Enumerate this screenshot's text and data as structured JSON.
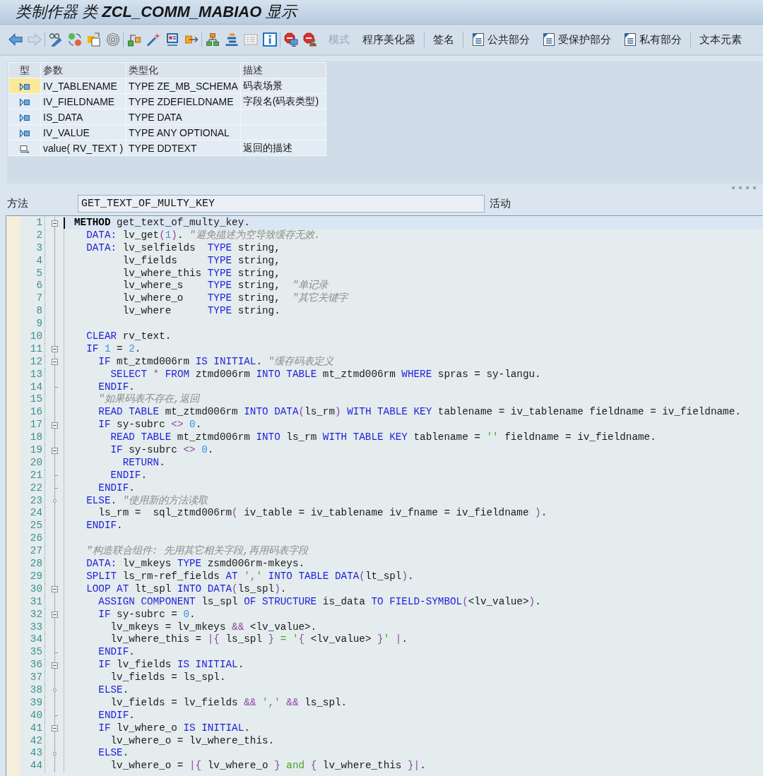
{
  "title": "类制作器 类 **ZCL_COMM_MABIAO** 显示",
  "toolbar": {
    "nav": [
      {
        "disabled": false
      },
      {
        "disabled": true
      }
    ],
    "buttons": [
      {
        "label": "模式",
        "kind": "plain",
        "disabled": true,
        "separator_before": false
      },
      {
        "label": "程序美化器",
        "kind": "plain",
        "disabled": false,
        "separator_before": false
      },
      {
        "label": "签名",
        "kind": "plain",
        "disabled": false,
        "separator_before": true
      },
      {
        "label": "公共部分",
        "kind": "section",
        "disabled": false,
        "separator_before": true
      },
      {
        "label": "受保护部分",
        "kind": "section",
        "disabled": false,
        "separator_before": false
      },
      {
        "label": "私有部分",
        "kind": "section",
        "disabled": false,
        "separator_before": false
      },
      {
        "label": "文本元素",
        "kind": "plain",
        "disabled": false,
        "separator_before": true
      }
    ]
  },
  "parameters": {
    "columns": [
      "型",
      "参数",
      "类型化",
      "描述"
    ],
    "rows": [
      {
        "kind": "importing",
        "selected": true,
        "parameter": "IV_TABLENAME",
        "typing": "TYPE ZE_MB_SCHEMA",
        "description": "码表场景"
      },
      {
        "kind": "importing",
        "selected": false,
        "parameter": "IV_FIELDNAME",
        "typing": "TYPE ZDEFIELDNAME",
        "description": "字段名(码表类型)"
      },
      {
        "kind": "importing",
        "selected": false,
        "parameter": "IS_DATA",
        "typing": "TYPE DATA"
      },
      {
        "kind": "importing",
        "selected": false,
        "parameter": "IV_VALUE",
        "typing": "TYPE ANY OPTIONAL"
      },
      {
        "kind": "returning",
        "selected": false,
        "parameter": "value( RV_TEXT )",
        "typing": "TYPE DDTEXT",
        "description": "返回的描述"
      }
    ]
  },
  "method": {
    "label": "方法",
    "name": "GET_TEXT_OF_MULTY_KEY",
    "status": "活动"
  },
  "code": {
    "lines": [
      {
        "number": "1",
        "current": true,
        "kind": "block_start",
        "tokens": [
          {
            "kind": "bold",
            "text": "METHOD"
          },
          {
            "kind": "plain",
            "text": " get_text_of_multy_key."
          }
        ]
      },
      {
        "number": "2",
        "current": false,
        "kind": "line",
        "tokens": [
          {
            "kind": "keyword",
            "text": "  DATA:"
          },
          {
            "kind": "plain",
            "text": " lv_get"
          },
          {
            "kind": "operator",
            "text": "("
          },
          {
            "kind": "number",
            "text": "1"
          },
          {
            "kind": "operator",
            "text": ")"
          },
          {
            "kind": "plain",
            "text": ". "
          },
          {
            "kind": "comment",
            "text": "\"避免描述为空导致缓存无效."
          }
        ]
      },
      {
        "number": "3",
        "current": false,
        "kind": "line",
        "tokens": [
          {
            "kind": "keyword",
            "text": "  DATA:"
          },
          {
            "kind": "plain",
            "text": " lv_selfields  "
          },
          {
            "kind": "keyword",
            "text": "TYPE"
          },
          {
            "kind": "plain",
            "text": " string,"
          }
        ]
      },
      {
        "number": "4",
        "current": false,
        "kind": "line",
        "tokens": [
          {
            "kind": "plain",
            "text": "        lv_fields     "
          },
          {
            "kind": "keyword",
            "text": "TYPE"
          },
          {
            "kind": "plain",
            "text": " string,"
          }
        ]
      },
      {
        "number": "5",
        "current": false,
        "kind": "line",
        "tokens": [
          {
            "kind": "plain",
            "text": "        lv_where_this "
          },
          {
            "kind": "keyword",
            "text": "TYPE"
          },
          {
            "kind": "plain",
            "text": " string,"
          }
        ]
      },
      {
        "number": "6",
        "current": false,
        "kind": "line",
        "tokens": [
          {
            "kind": "plain",
            "text": "        lv_where_s    "
          },
          {
            "kind": "keyword",
            "text": "TYPE"
          },
          {
            "kind": "plain",
            "text": " string,  "
          },
          {
            "kind": "comment",
            "text": "\"单记录"
          }
        ]
      },
      {
        "number": "7",
        "current": false,
        "kind": "line",
        "tokens": [
          {
            "kind": "plain",
            "text": "        lv_where_o    "
          },
          {
            "kind": "keyword",
            "text": "TYPE"
          },
          {
            "kind": "plain",
            "text": " string,  "
          },
          {
            "kind": "comment",
            "text": "\"其它关键字"
          }
        ]
      },
      {
        "number": "8",
        "current": false,
        "kind": "line",
        "tokens": [
          {
            "kind": "plain",
            "text": "        lv_where      "
          },
          {
            "kind": "keyword",
            "text": "TYPE"
          },
          {
            "kind": "plain",
            "text": " string."
          }
        ]
      },
      {
        "number": "9",
        "current": false,
        "kind": "line"
      },
      {
        "number": "10",
        "current": false,
        "kind": "line",
        "tokens": [
          {
            "kind": "keyword",
            "text": "  CLEAR"
          },
          {
            "kind": "plain",
            "text": " rv_text."
          }
        ]
      },
      {
        "number": "11",
        "current": false,
        "kind": "block_start",
        "tokens": [
          {
            "kind": "keyword",
            "text": "  IF "
          },
          {
            "kind": "number",
            "text": "1"
          },
          {
            "kind": "plain",
            "text": " = "
          },
          {
            "kind": "number",
            "text": "2"
          },
          {
            "kind": "plain",
            "text": "."
          }
        ]
      },
      {
        "number": "12",
        "current": false,
        "kind": "block_start",
        "tokens": [
          {
            "kind": "keyword",
            "text": "    IF"
          },
          {
            "kind": "plain",
            "text": " mt_ztmd006rm "
          },
          {
            "kind": "keyword",
            "text": "IS INITIAL"
          },
          {
            "kind": "plain",
            "text": ". "
          },
          {
            "kind": "comment",
            "text": "\"缓存码表定义"
          }
        ]
      },
      {
        "number": "13",
        "current": false,
        "kind": "line",
        "tokens": [
          {
            "kind": "keyword",
            "text": "      SELECT "
          },
          {
            "kind": "operator",
            "text": "*"
          },
          {
            "kind": "keyword",
            "text": " FROM"
          },
          {
            "kind": "plain",
            "text": " ztmd006rm "
          },
          {
            "kind": "keyword",
            "text": "INTO TABLE"
          },
          {
            "kind": "plain",
            "text": " mt_ztmd006rm "
          },
          {
            "kind": "keyword",
            "text": "WHERE"
          },
          {
            "kind": "plain",
            "text": " spras = sy-langu."
          }
        ]
      },
      {
        "number": "14",
        "current": false,
        "kind": "block_end",
        "tokens": [
          {
            "kind": "keyword",
            "text": "    ENDIF"
          },
          {
            "kind": "plain",
            "text": "."
          }
        ]
      },
      {
        "number": "15",
        "current": false,
        "kind": "line",
        "tokens": [
          {
            "kind": "comment",
            "text": "    \"如果码表不存在,返回"
          }
        ]
      },
      {
        "number": "16",
        "current": false,
        "kind": "line",
        "tokens": [
          {
            "kind": "keyword",
            "text": "    READ TABLE"
          },
          {
            "kind": "plain",
            "text": " mt_ztmd006rm "
          },
          {
            "kind": "keyword",
            "text": "INTO DATA"
          },
          {
            "kind": "operator",
            "text": "("
          },
          {
            "kind": "plain",
            "text": "ls_rm"
          },
          {
            "kind": "operator",
            "text": ")"
          },
          {
            "kind": "keyword",
            "text": " WITH TABLE KEY"
          },
          {
            "kind": "plain",
            "text": " tablename = iv_tablename fieldname = iv_fieldname."
          }
        ]
      },
      {
        "number": "17",
        "current": false,
        "kind": "block_start",
        "tokens": [
          {
            "kind": "keyword",
            "text": "    IF"
          },
          {
            "kind": "plain",
            "text": " sy-subrc "
          },
          {
            "kind": "operator",
            "text": "<>"
          },
          {
            "kind": "number",
            "text": " 0"
          },
          {
            "kind": "plain",
            "text": "."
          }
        ]
      },
      {
        "number": "18",
        "current": false,
        "kind": "line",
        "tokens": [
          {
            "kind": "keyword",
            "text": "      READ TABLE"
          },
          {
            "kind": "plain",
            "text": " mt_ztmd006rm "
          },
          {
            "kind": "keyword",
            "text": "INTO"
          },
          {
            "kind": "plain",
            "text": " ls_rm "
          },
          {
            "kind": "keyword",
            "text": "WITH TABLE KEY"
          },
          {
            "kind": "plain",
            "text": " tablename = "
          },
          {
            "kind": "string",
            "text": "''"
          },
          {
            "kind": "plain",
            "text": " fieldname = iv_fieldname."
          }
        ]
      },
      {
        "number": "19",
        "current": false,
        "kind": "block_start",
        "tokens": [
          {
            "kind": "keyword",
            "text": "      IF"
          },
          {
            "kind": "plain",
            "text": " sy-subrc "
          },
          {
            "kind": "operator",
            "text": "<>"
          },
          {
            "kind": "number",
            "text": " 0"
          },
          {
            "kind": "plain",
            "text": "."
          }
        ]
      },
      {
        "number": "20",
        "current": false,
        "kind": "line",
        "tokens": [
          {
            "kind": "keyword",
            "text": "        RETURN"
          },
          {
            "kind": "plain",
            "text": "."
          }
        ]
      },
      {
        "number": "21",
        "current": false,
        "kind": "block_end",
        "tokens": [
          {
            "kind": "keyword",
            "text": "      ENDIF"
          },
          {
            "kind": "plain",
            "text": "."
          }
        ]
      },
      {
        "number": "22",
        "current": false,
        "kind": "block_end",
        "tokens": [
          {
            "kind": "keyword",
            "text": "    ENDIF"
          },
          {
            "kind": "plain",
            "text": "."
          }
        ]
      },
      {
        "number": "23",
        "current": false,
        "kind": "block_branch",
        "tokens": [
          {
            "kind": "keyword",
            "text": "  ELSE"
          },
          {
            "kind": "plain",
            "text": ". "
          },
          {
            "kind": "comment",
            "text": "\"使用新的方法读取"
          }
        ]
      },
      {
        "number": "24",
        "current": false,
        "kind": "line",
        "tokens": [
          {
            "kind": "plain",
            "text": "    ls_rm =  sql_ztmd006rm"
          },
          {
            "kind": "operator",
            "text": "("
          },
          {
            "kind": "plain",
            "text": " iv_table = iv_tablename iv_fname = iv_fieldname "
          },
          {
            "kind": "operator",
            "text": ")"
          },
          {
            "kind": "plain",
            "text": "."
          }
        ]
      },
      {
        "number": "25",
        "current": false,
        "kind": "line",
        "tokens": [
          {
            "kind": "keyword",
            "text": "  ENDIF"
          },
          {
            "kind": "plain",
            "text": "."
          }
        ]
      },
      {
        "number": "26",
        "current": false,
        "kind": "line"
      },
      {
        "number": "27",
        "current": false,
        "kind": "line",
        "tokens": [
          {
            "kind": "comment",
            "text": "  \"构造联合组件: 先用其它相关字段,再用码表字段"
          }
        ]
      },
      {
        "number": "28",
        "current": false,
        "kind": "line",
        "tokens": [
          {
            "kind": "keyword",
            "text": "  DATA:"
          },
          {
            "kind": "plain",
            "text": " lv_mkeys "
          },
          {
            "kind": "keyword",
            "text": "TYPE"
          },
          {
            "kind": "plain",
            "text": " zsmd006rm-mkeys."
          }
        ]
      },
      {
        "number": "29",
        "current": false,
        "kind": "line",
        "tokens": [
          {
            "kind": "keyword",
            "text": "  SPLIT"
          },
          {
            "kind": "plain",
            "text": " ls_rm-ref_fields "
          },
          {
            "kind": "keyword",
            "text": "AT "
          },
          {
            "kind": "string",
            "text": "','"
          },
          {
            "kind": "keyword",
            "text": " INTO TABLE DATA"
          },
          {
            "kind": "operator",
            "text": "("
          },
          {
            "kind": "plain",
            "text": "lt_spl"
          },
          {
            "kind": "operator",
            "text": ")"
          },
          {
            "kind": "plain",
            "text": "."
          }
        ]
      },
      {
        "number": "30",
        "current": false,
        "kind": "block_start",
        "tokens": [
          {
            "kind": "keyword",
            "text": "  LOOP AT"
          },
          {
            "kind": "plain",
            "text": " lt_spl "
          },
          {
            "kind": "keyword",
            "text": "INTO DATA"
          },
          {
            "kind": "operator",
            "text": "("
          },
          {
            "kind": "plain",
            "text": "ls_spl"
          },
          {
            "kind": "operator",
            "text": ")"
          },
          {
            "kind": "plain",
            "text": "."
          }
        ]
      },
      {
        "number": "31",
        "current": false,
        "kind": "line",
        "tokens": [
          {
            "kind": "keyword",
            "text": "    ASSIGN COMPONENT"
          },
          {
            "kind": "plain",
            "text": " ls_spl "
          },
          {
            "kind": "keyword",
            "text": "OF STRUCTURE"
          },
          {
            "kind": "plain",
            "text": " is_data "
          },
          {
            "kind": "keyword",
            "text": "TO FIELD-SYMBOL"
          },
          {
            "kind": "operator",
            "text": "("
          },
          {
            "kind": "plain",
            "text": "<lv_value>"
          },
          {
            "kind": "operator",
            "text": ")"
          },
          {
            "kind": "plain",
            "text": "."
          }
        ]
      },
      {
        "number": "32",
        "current": false,
        "kind": "block_start",
        "tokens": [
          {
            "kind": "keyword",
            "text": "    IF"
          },
          {
            "kind": "plain",
            "text": " sy-subrc = "
          },
          {
            "kind": "number",
            "text": "0"
          },
          {
            "kind": "plain",
            "text": "."
          }
        ]
      },
      {
        "number": "33",
        "current": false,
        "kind": "line",
        "tokens": [
          {
            "kind": "plain",
            "text": "      lv_mkeys = lv_mkeys "
          },
          {
            "kind": "operator",
            "text": "&&"
          },
          {
            "kind": "plain",
            "text": " <lv_value>."
          }
        ]
      },
      {
        "number": "34",
        "current": false,
        "kind": "line",
        "tokens": [
          {
            "kind": "plain",
            "text": "      lv_where_this = "
          },
          {
            "kind": "operator",
            "text": "|{"
          },
          {
            "kind": "plain",
            "text": " ls_spl "
          },
          {
            "kind": "operator",
            "text": "}"
          },
          {
            "kind": "string",
            "text": " = '"
          },
          {
            "kind": "operator",
            "text": "{"
          },
          {
            "kind": "plain",
            "text": " <lv_value> "
          },
          {
            "kind": "operator",
            "text": "}"
          },
          {
            "kind": "string",
            "text": "' "
          },
          {
            "kind": "operator",
            "text": "|"
          },
          {
            "kind": "plain",
            "text": "."
          }
        ]
      },
      {
        "number": "35",
        "current": false,
        "kind": "block_end",
        "tokens": [
          {
            "kind": "keyword",
            "text": "    ENDIF"
          },
          {
            "kind": "plain",
            "text": "."
          }
        ]
      },
      {
        "number": "36",
        "current": false,
        "kind": "block_start",
        "tokens": [
          {
            "kind": "keyword",
            "text": "    IF"
          },
          {
            "kind": "plain",
            "text": " lv_fields "
          },
          {
            "kind": "keyword",
            "text": "IS INITIAL"
          },
          {
            "kind": "plain",
            "text": "."
          }
        ]
      },
      {
        "number": "37",
        "current": false,
        "kind": "line",
        "tokens": [
          {
            "kind": "plain",
            "text": "      lv_fields = ls_spl."
          }
        ]
      },
      {
        "number": "38",
        "current": false,
        "kind": "block_branch",
        "tokens": [
          {
            "kind": "keyword",
            "text": "    ELSE"
          },
          {
            "kind": "plain",
            "text": "."
          }
        ]
      },
      {
        "number": "39",
        "current": false,
        "kind": "line",
        "tokens": [
          {
            "kind": "plain",
            "text": "      lv_fields = lv_fields "
          },
          {
            "kind": "operator",
            "text": "&& "
          },
          {
            "kind": "string",
            "text": "','"
          },
          {
            "kind": "operator",
            "text": " &&"
          },
          {
            "kind": "plain",
            "text": " ls_spl."
          }
        ]
      },
      {
        "number": "40",
        "current": false,
        "kind": "block_end",
        "tokens": [
          {
            "kind": "keyword",
            "text": "    ENDIF"
          },
          {
            "kind": "plain",
            "text": "."
          }
        ]
      },
      {
        "number": "41",
        "current": false,
        "kind": "block_start",
        "tokens": [
          {
            "kind": "keyword",
            "text": "    IF"
          },
          {
            "kind": "plain",
            "text": " lv_where_o "
          },
          {
            "kind": "keyword",
            "text": "IS INITIAL"
          },
          {
            "kind": "plain",
            "text": "."
          }
        ]
      },
      {
        "number": "42",
        "current": false,
        "kind": "line",
        "tokens": [
          {
            "kind": "plain",
            "text": "      lv_where_o = lv_where_this."
          }
        ]
      },
      {
        "number": "43",
        "current": false,
        "kind": "block_branch",
        "tokens": [
          {
            "kind": "keyword",
            "text": "    ELSE"
          },
          {
            "kind": "plain",
            "text": "."
          }
        ]
      },
      {
        "number": "44",
        "current": false,
        "kind": "line",
        "tokens": [
          {
            "kind": "plain",
            "text": "      lv_where_o = "
          },
          {
            "kind": "operator",
            "text": "|{"
          },
          {
            "kind": "plain",
            "text": " lv_where_o "
          },
          {
            "kind": "operator",
            "text": "}"
          },
          {
            "kind": "string",
            "text": " and "
          },
          {
            "kind": "operator",
            "text": "{"
          },
          {
            "kind": "plain",
            "text": " lv_where_this "
          },
          {
            "kind": "operator",
            "text": "}|"
          },
          {
            "kind": "plain",
            "text": "."
          }
        ]
      }
    ]
  }
}
